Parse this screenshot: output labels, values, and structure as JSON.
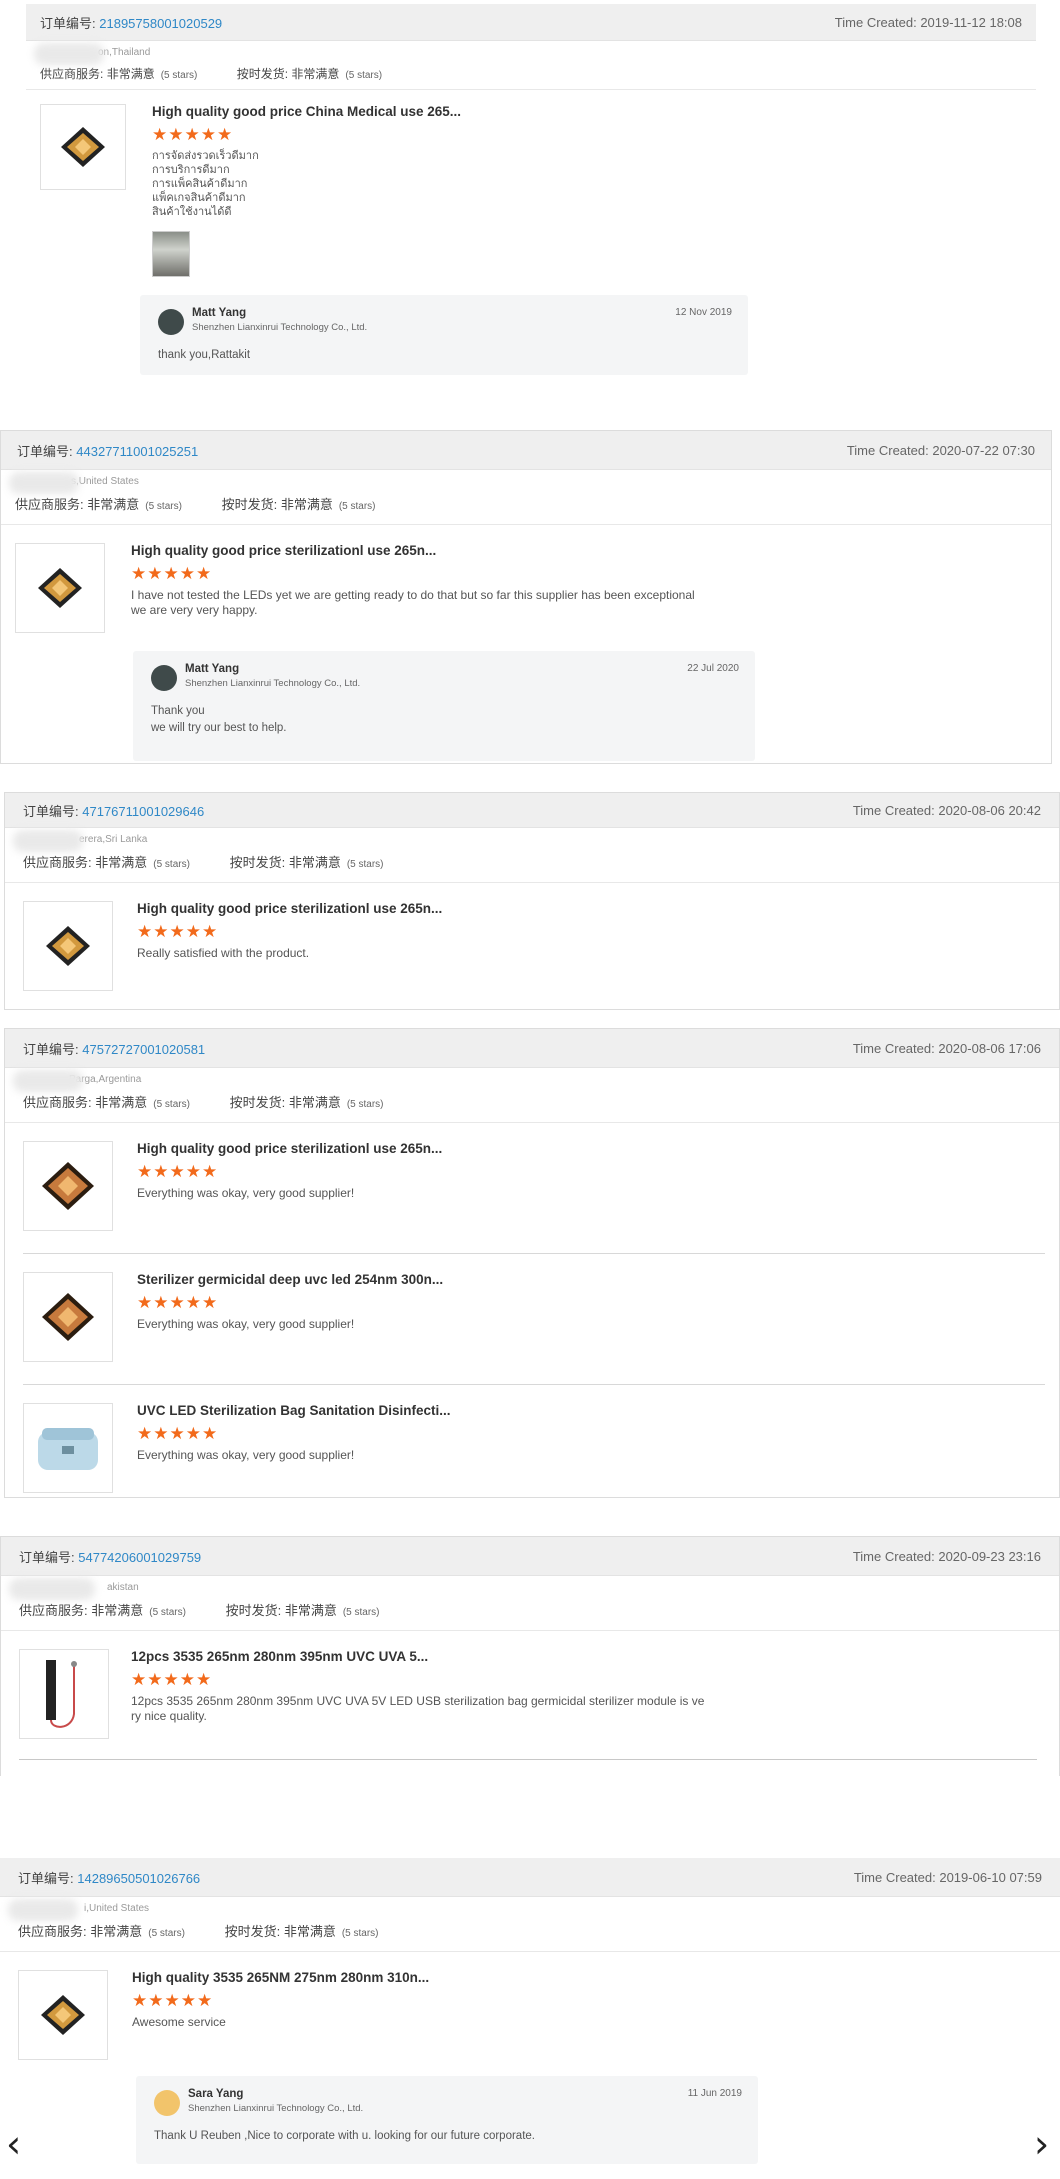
{
  "order_label": "订单编号:",
  "time_label": "Time Created:",
  "supplier_service_label": "供应商服务:",
  "on_time_label": "按时发货:",
  "rating_value": "非常满意",
  "rating_stars": "(5 stars)",
  "stars": "★★★★★",
  "orders": [
    {
      "order_no": "21895758001020529",
      "time": "2019-11-12 18:08",
      "buyer": "on,Thailand",
      "products": [
        {
          "title": "High quality good price China Medical use 265...",
          "review": "การจัดส่งรวดเร็วดีมาก\nการบริการดีมาก\nการแพ็คสินค้าดีมาก\nแพ็คเกจสินค้าดีมาก\nสินค้าใช้งานได้ดี"
        }
      ],
      "reply": {
        "name": "Matt Yang",
        "company": "Shenzhen Lianxinrui Technology Co., Ltd.",
        "date": "12 Nov 2019",
        "text": "thank you,Rattakit"
      }
    },
    {
      "order_no": "44327711001025251",
      "time": "2020-07-22 07:30",
      "buyer": "s,United States",
      "products": [
        {
          "title": "High quality good price sterilizationl use 265n...",
          "review": "I have not tested the LEDs yet we are getting ready to do that but so far this supplier has been exceptional\nwe are very very happy."
        }
      ],
      "reply": {
        "name": "Matt Yang",
        "company": "Shenzhen Lianxinrui Technology Co., Ltd.",
        "date": "22 Jul 2020",
        "text": "Thank you\nwe will try our best to help."
      }
    },
    {
      "order_no": "47176711001029646",
      "time": "2020-08-06 20:42",
      "buyer": "erera,Sri Lanka",
      "products": [
        {
          "title": "High quality good price sterilizationl use 265n...",
          "review": "Really satisfied with the product."
        }
      ]
    },
    {
      "order_no": "47572727001020581",
      "time": "2020-08-06 17:06",
      "buyer": "Parga,Argentina",
      "products": [
        {
          "title": "High quality good price sterilizationl use 265n...",
          "review": "Everything was okay, very good supplier!"
        },
        {
          "title": "Sterilizer germicidal deep uvc led 254nm 300n...",
          "review": "Everything was okay, very good supplier!"
        },
        {
          "title": "UVC LED Sterilization Bag Sanitation Disinfecti...",
          "review": "Everything was okay, very good supplier!"
        }
      ]
    },
    {
      "order_no": "54774206001029759",
      "time": "2020-09-23 23:16",
      "buyer": "akistan",
      "products": [
        {
          "title": "12pcs 3535 265nm 280nm 395nm UVC UVA 5...",
          "review": "12pcs 3535 265nm 280nm 395nm UVC UVA 5V LED USB sterilization bag germicidal sterilizer module is ve\nry nice quality."
        }
      ]
    },
    {
      "order_no": "14289650501026766",
      "time": "2019-06-10 07:59",
      "buyer": "i,United States",
      "products": [
        {
          "title": "High quality 3535 265NM 275nm 280nm 310n...",
          "review": "Awesome service"
        }
      ],
      "reply": {
        "name": "Sara Yang",
        "company": "Shenzhen Lianxinrui Technology Co., Ltd.",
        "date": "11 Jun 2019",
        "text": "Thank U Reuben ,Nice to corporate with u. looking for our  future corporate."
      }
    }
  ],
  "nav": {
    "prev": "‹",
    "next": "›"
  }
}
